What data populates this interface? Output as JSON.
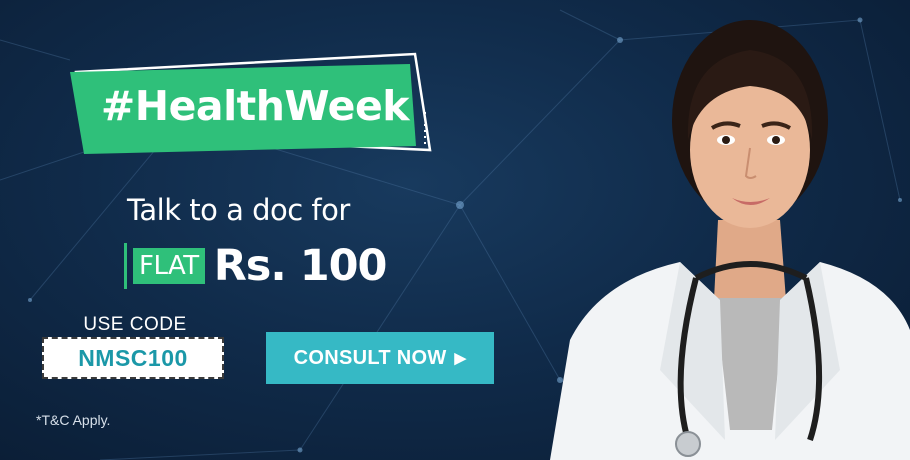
{
  "banner": {
    "hashtag": "#HealthWeek",
    "tagline": "Talk to a doc for",
    "flat_label": "FLAT",
    "price": "Rs. 100",
    "use_code_label": "USE CODE",
    "code": "NMSC100",
    "cta_label": "CONSULT NOW",
    "cta_icon": "play-triangle-icon",
    "terms": "*T&C Apply."
  },
  "colors": {
    "background": "#102b4a",
    "accent_green": "#2fc07a",
    "cta": "#36b9c5",
    "code_text": "#1b98a8"
  }
}
